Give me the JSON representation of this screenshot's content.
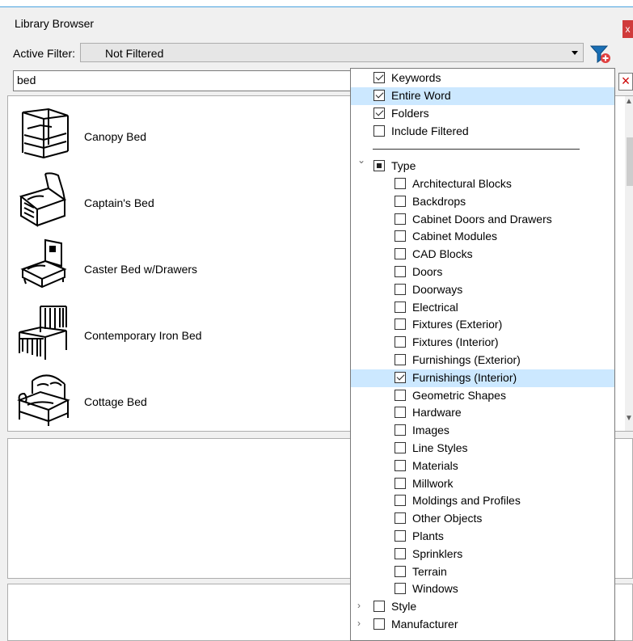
{
  "window": {
    "title": "Library Browser",
    "close_label": "x"
  },
  "filter": {
    "label": "Active Filter:",
    "value": "Not Filtered"
  },
  "search": {
    "value": "bed"
  },
  "results": [
    {
      "name": "Canopy Bed",
      "icon": "canopy-bed"
    },
    {
      "name": "Captain's Bed",
      "icon": "captains-bed"
    },
    {
      "name": "Caster Bed w/Drawers",
      "icon": "caster-bed"
    },
    {
      "name": "Contemporary Iron Bed",
      "icon": "iron-bed"
    },
    {
      "name": "Cottage Bed",
      "icon": "cottage-bed"
    }
  ],
  "search_options": [
    {
      "label": "Keywords",
      "checked": true
    },
    {
      "label": "Entire Word",
      "checked": true,
      "highlighted": true
    },
    {
      "label": "Folders",
      "checked": true
    },
    {
      "label": "Include Filtered",
      "checked": false
    }
  ],
  "type_group": {
    "label": "Type",
    "expanded": true,
    "state": "partial",
    "items": [
      {
        "label": "Architectural Blocks",
        "checked": false
      },
      {
        "label": "Backdrops",
        "checked": false
      },
      {
        "label": "Cabinet Doors and Drawers",
        "checked": false
      },
      {
        "label": "Cabinet Modules",
        "checked": false
      },
      {
        "label": "CAD Blocks",
        "checked": false
      },
      {
        "label": "Doors",
        "checked": false
      },
      {
        "label": "Doorways",
        "checked": false
      },
      {
        "label": "Electrical",
        "checked": false
      },
      {
        "label": "Fixtures (Exterior)",
        "checked": false
      },
      {
        "label": "Fixtures (Interior)",
        "checked": false
      },
      {
        "label": "Furnishings (Exterior)",
        "checked": false
      },
      {
        "label": "Furnishings (Interior)",
        "checked": true,
        "highlighted": true
      },
      {
        "label": "Geometric Shapes",
        "checked": false
      },
      {
        "label": "Hardware",
        "checked": false
      },
      {
        "label": "Images",
        "checked": false
      },
      {
        "label": "Line Styles",
        "checked": false
      },
      {
        "label": "Materials",
        "checked": false
      },
      {
        "label": "Millwork",
        "checked": false
      },
      {
        "label": "Moldings and Profiles",
        "checked": false
      },
      {
        "label": "Other Objects",
        "checked": false
      },
      {
        "label": "Plants",
        "checked": false
      },
      {
        "label": "Sprinklers",
        "checked": false
      },
      {
        "label": "Terrain",
        "checked": false
      },
      {
        "label": "Windows",
        "checked": false
      }
    ]
  },
  "collapsed_groups": [
    {
      "label": "Style",
      "checked": false
    },
    {
      "label": "Manufacturer",
      "checked": false
    }
  ],
  "colors": {
    "highlight": "#cce8ff",
    "close_button": "#d03b3b",
    "filter_icon": "#1a6fb5"
  }
}
